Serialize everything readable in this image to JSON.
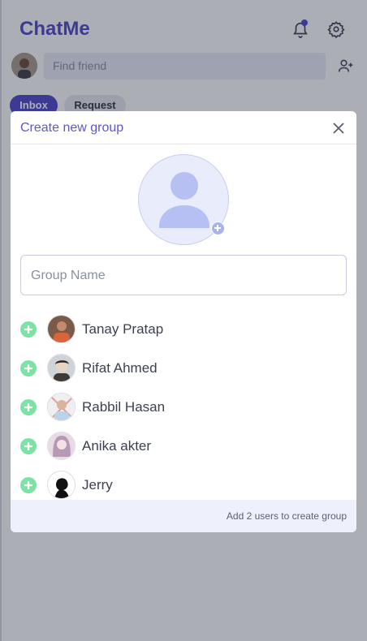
{
  "app": {
    "title": "ChatMe",
    "search_placeholder": "Find friend",
    "tabs": [
      {
        "label": "Inbox"
      },
      {
        "label": "Request"
      }
    ],
    "accent": "#4c45c9"
  },
  "modal": {
    "title": "Create new group",
    "group_name_placeholder": "Group Name",
    "users": [
      {
        "name": "Tanay Pratap"
      },
      {
        "name": "Rifat Ahmed"
      },
      {
        "name": "Rabbil Hasan"
      },
      {
        "name": "Anika akter"
      },
      {
        "name": "Jerry"
      }
    ],
    "footer": "Add 2 users to create group"
  }
}
